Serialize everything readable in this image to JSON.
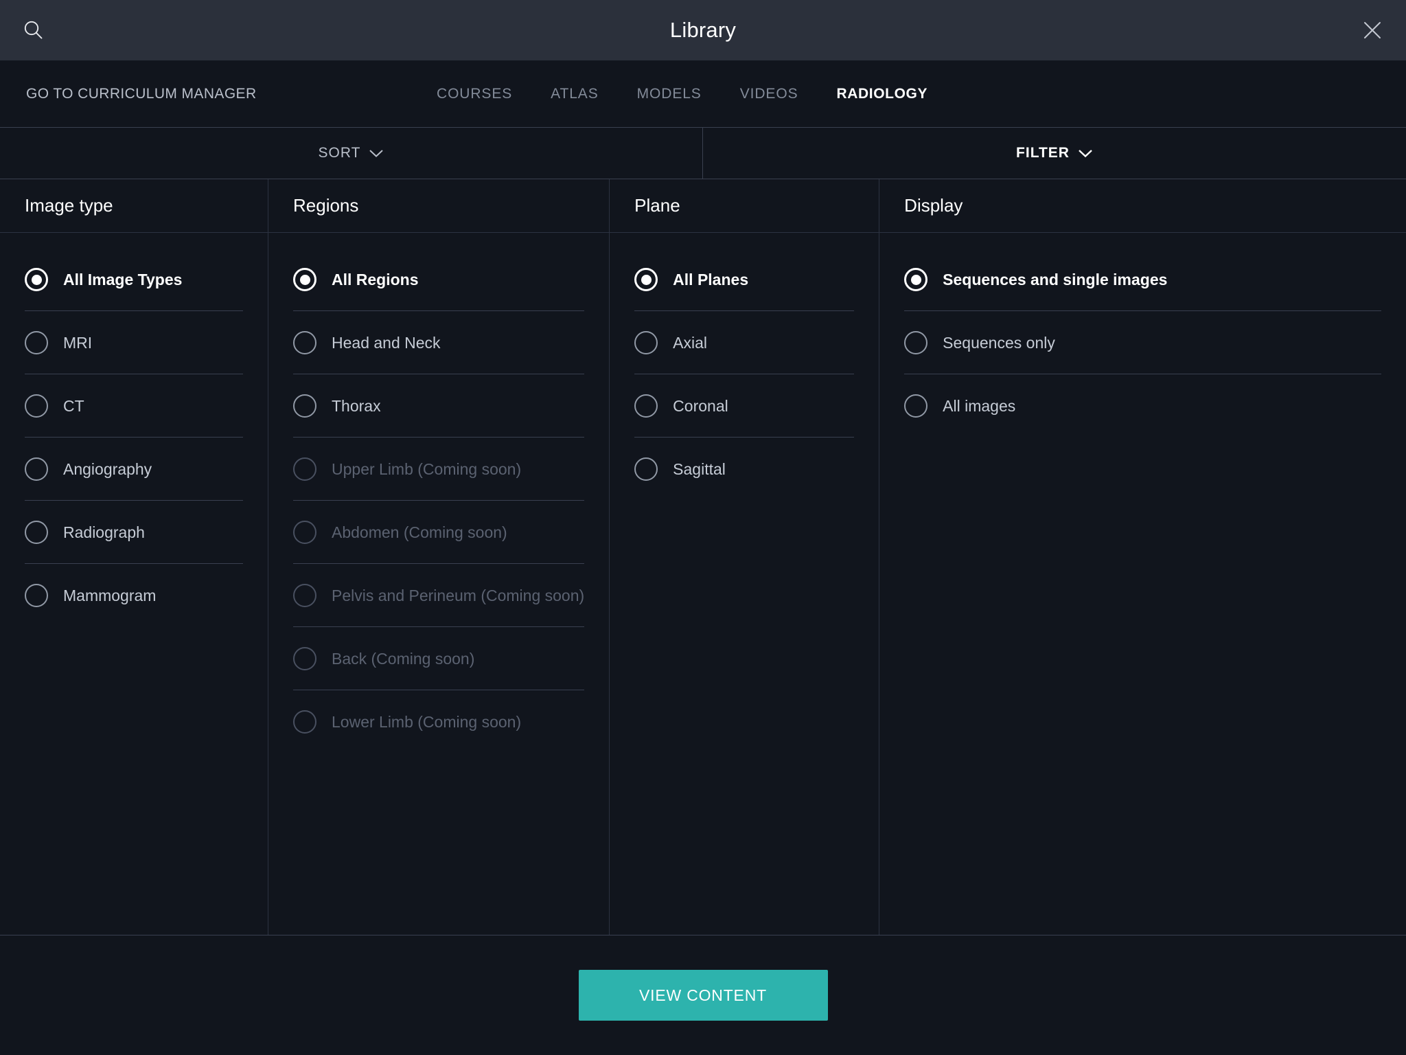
{
  "window": {
    "title": "Library",
    "search_icon": "search-icon",
    "close_icon": "close-icon"
  },
  "nav": {
    "curriculum_link": "GO TO CURRICULUM MANAGER",
    "tabs": [
      {
        "label": "COURSES",
        "active": false
      },
      {
        "label": "ATLAS",
        "active": false
      },
      {
        "label": "MODELS",
        "active": false
      },
      {
        "label": "VIDEOS",
        "active": false
      },
      {
        "label": "RADIOLOGY",
        "active": true
      }
    ]
  },
  "sortfilter": {
    "sort_label": "SORT",
    "filter_label": "FILTER",
    "chevron_icon": "chevron-down-icon"
  },
  "columns": [
    {
      "title": "Image type",
      "options": [
        {
          "label": "All Image Types",
          "selected": true,
          "disabled": false
        },
        {
          "label": "MRI",
          "selected": false,
          "disabled": false
        },
        {
          "label": "CT",
          "selected": false,
          "disabled": false
        },
        {
          "label": "Angiography",
          "selected": false,
          "disabled": false
        },
        {
          "label": "Radiograph",
          "selected": false,
          "disabled": false
        },
        {
          "label": "Mammogram",
          "selected": false,
          "disabled": false
        }
      ]
    },
    {
      "title": "Regions",
      "options": [
        {
          "label": "All Regions",
          "selected": true,
          "disabled": false
        },
        {
          "label": "Head and Neck",
          "selected": false,
          "disabled": false
        },
        {
          "label": "Thorax",
          "selected": false,
          "disabled": false
        },
        {
          "label": "Upper Limb (Coming soon)",
          "selected": false,
          "disabled": true
        },
        {
          "label": "Abdomen (Coming soon)",
          "selected": false,
          "disabled": true
        },
        {
          "label": "Pelvis and Perineum (Coming soon)",
          "selected": false,
          "disabled": true
        },
        {
          "label": "Back (Coming soon)",
          "selected": false,
          "disabled": true
        },
        {
          "label": "Lower Limb (Coming soon)",
          "selected": false,
          "disabled": true
        }
      ]
    },
    {
      "title": "Plane",
      "options": [
        {
          "label": "All Planes",
          "selected": true,
          "disabled": false
        },
        {
          "label": "Axial",
          "selected": false,
          "disabled": false
        },
        {
          "label": "Coronal",
          "selected": false,
          "disabled": false
        },
        {
          "label": "Sagittal",
          "selected": false,
          "disabled": false
        }
      ]
    },
    {
      "title": "Display",
      "options": [
        {
          "label": "Sequences and single images",
          "selected": true,
          "disabled": false
        },
        {
          "label": "Sequences only",
          "selected": false,
          "disabled": false
        },
        {
          "label": "All images",
          "selected": false,
          "disabled": false
        }
      ]
    }
  ],
  "footer": {
    "view_content_label": "VIEW CONTENT"
  },
  "colors": {
    "accent": "#2db3ad",
    "window_bar": "#2b303b",
    "background": "#11151d",
    "divider": "#3a4050",
    "text_muted": "#c6ccd6",
    "text_disabled": "#5b6271"
  }
}
